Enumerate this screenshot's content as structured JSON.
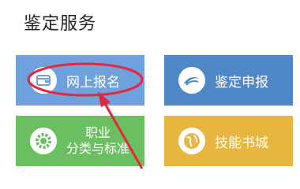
{
  "section": {
    "title": "鉴定服务"
  },
  "tiles": [
    {
      "label": "网上报名",
      "icon": "wallet-icon"
    },
    {
      "label": "鉴定申报",
      "icon": "swoosh-icon"
    },
    {
      "label_line1": "职业",
      "label_line2": "分类与标准",
      "icon": "gear-icon"
    },
    {
      "label": "技能书城",
      "icon": "globe-icon"
    }
  ],
  "colors": {
    "online_tile": "#6fa1dd",
    "apply_tile": "#4f87c9",
    "career_tile": "#6bbf61",
    "mall_tile": "#e6b63f",
    "annotation": "#e8253a"
  }
}
